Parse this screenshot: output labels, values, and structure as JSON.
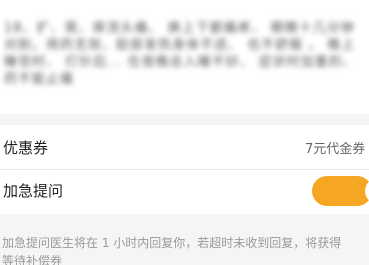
{
  "description": {
    "text": "18、扩、晃、痒流头痛、  换上下都痛疼、 眼睛十几分钟对耐。用药无效、脸部发热身体不适、 也不舒服 。 晚上睡觉时、 打针后... 在夜晚总入睡不好、 症状时加重的、 药不能止痛"
  },
  "coupon": {
    "label": "优惠券",
    "value": "7元代金券"
  },
  "urgent": {
    "label": "加急提问",
    "toggle_on": true,
    "toggle_color": "#f5a623"
  },
  "note": {
    "line1": "加急提问医生将在 1 小时内回复你，若超时未收到回复，将获得",
    "line2": "等待补偿券"
  }
}
